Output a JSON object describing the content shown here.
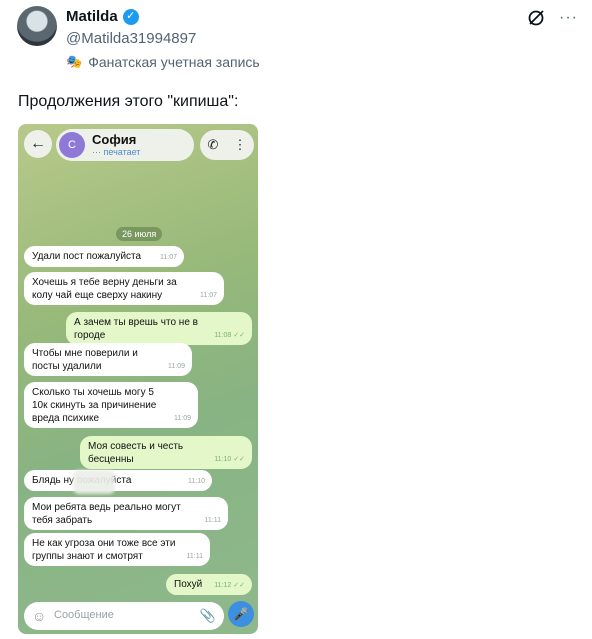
{
  "tweet": {
    "display_name": "Matilda",
    "handle": "@Matilda31994897",
    "badge_label": "Фанатская учетная запись",
    "text": "Продолжения этого \"кипиша\":"
  },
  "icons": {
    "verified": "verified-badge-icon",
    "grok": "slash-circle-icon",
    "more": "more-icon",
    "fan": "theater-mask-icon"
  },
  "chat": {
    "back_icon": "←",
    "contact_initial": "С",
    "contact_name": "София",
    "contact_status": "··· печатает",
    "call_icon": "✆",
    "menu_icon": "⋮",
    "date": "26 июля",
    "messages": [
      {
        "dir": "in",
        "text": "Удали пост пожалуйста",
        "time": "11:07"
      },
      {
        "dir": "in",
        "text": "Хочешь я тебе верну деньги за колу чай еще сверху накину",
        "time": "11:07"
      },
      {
        "dir": "out",
        "text": "А зачем ты врешь что не в городе",
        "time": "11:08 ✓✓"
      },
      {
        "dir": "in",
        "text": "Чтобы мне поверили и посты удалили",
        "time": "11:09"
      },
      {
        "dir": "in",
        "text": "Сколько ты хочешь могу 5 10к скинуть за причинение вреда психике",
        "time": "11:09"
      },
      {
        "dir": "out",
        "text": "Моя совесть и честь бесценны",
        "time": "11:10 ✓✓"
      },
      {
        "dir": "in",
        "text": "Блядь ну пожалуйста",
        "time": "11:10"
      },
      {
        "dir": "in",
        "text": "Мои ребята ведь реально могут тебя забрать",
        "time": "11:11"
      },
      {
        "dir": "in",
        "text": "Не как угроза они тоже все эти группы знают и смотрят",
        "time": "11:11"
      },
      {
        "dir": "out",
        "text": "Похуй",
        "time": "11:12 ✓✓"
      }
    ],
    "composer_placeholder": "Сообщение",
    "colors": {
      "incoming": "#ffffff",
      "outgoing": "#e3f7c9",
      "accent": "#3d8fe0"
    }
  }
}
